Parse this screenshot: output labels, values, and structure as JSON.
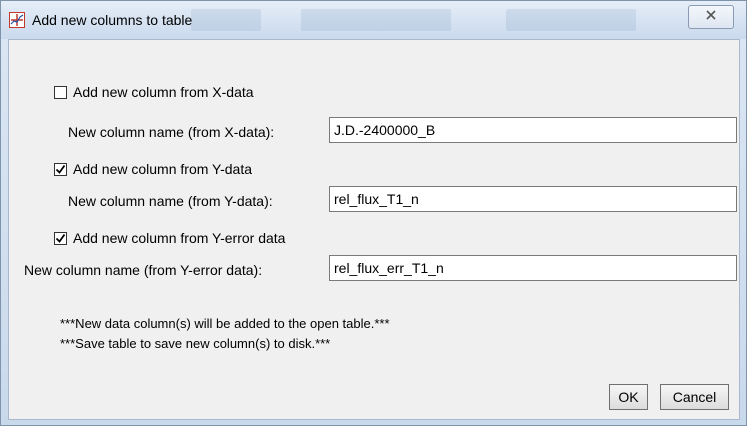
{
  "window": {
    "title": "Add new columns to table",
    "title_icon": "chart-plus-icon",
    "close_icon": "close-icon"
  },
  "x_data": {
    "checkbox_label": "Add new column from X-data",
    "checked": false,
    "name_label": "New column name (from X-data):",
    "name_value": "J.D.-2400000_B"
  },
  "y_data": {
    "checkbox_label": "Add new column from Y-data",
    "checked": true,
    "name_label": "New column name (from Y-data):",
    "name_value": "rel_flux_T1_n"
  },
  "y_error": {
    "checkbox_label": "Add new column from Y-error data",
    "checked": true,
    "name_label": "New column name (from Y-error data):",
    "name_value": "rel_flux_err_T1_n"
  },
  "notes": {
    "line1": "***New data column(s) will be added to the open table.***",
    "line2": "***Save table to save new column(s) to disk.***"
  },
  "buttons": {
    "ok": "OK",
    "cancel": "Cancel"
  }
}
